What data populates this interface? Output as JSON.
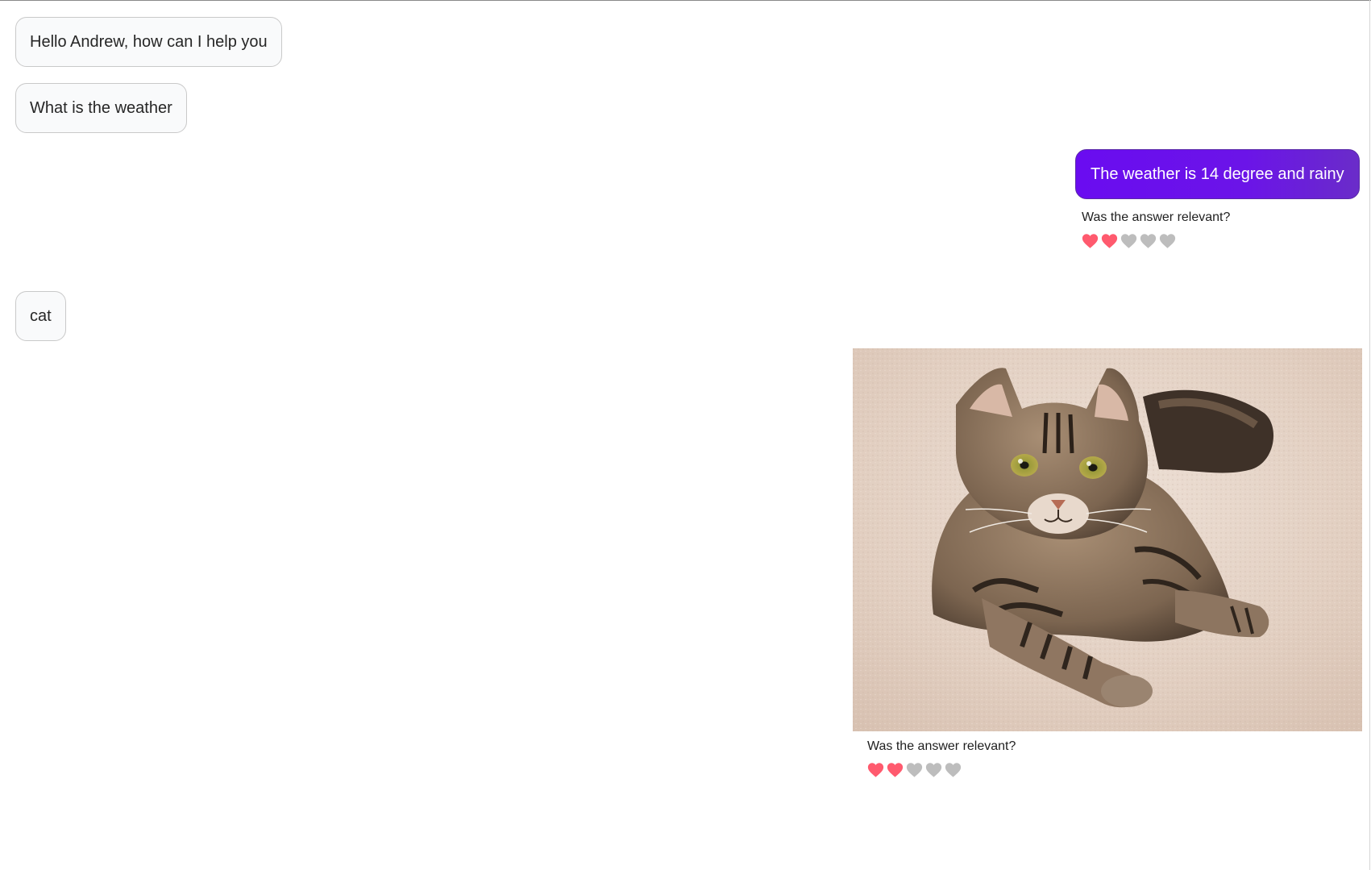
{
  "messages": {
    "greeting": "Hello Andrew, how can I help you",
    "question": "What is the weather",
    "cat_query": "cat"
  },
  "bot_answer": {
    "text": "The weather is 14 degree and rainy",
    "feedback_question": "Was the answer relevant?",
    "rating": 2,
    "max_rating": 5
  },
  "image_answer": {
    "image": "cat-photo",
    "feedback_question": "Was the answer relevant?",
    "rating": 2,
    "max_rating": 5
  },
  "colors": {
    "heart_active": "#ff5a6e",
    "heart_inactive": "#bdbdbd",
    "bot_bubble": "#6a0cf0"
  }
}
